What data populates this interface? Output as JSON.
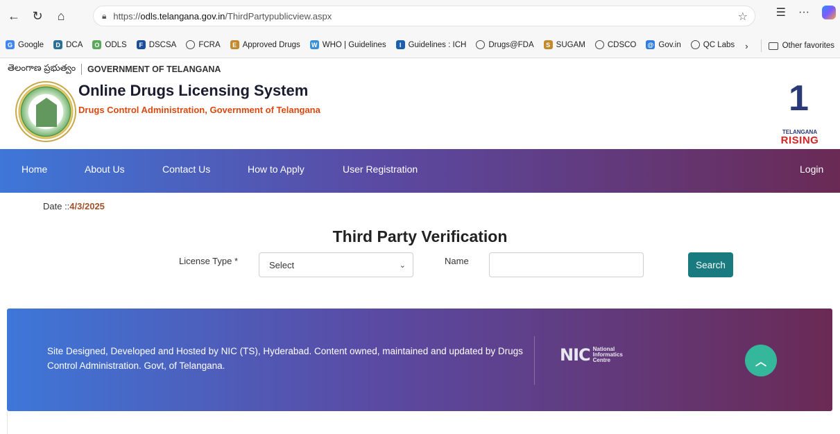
{
  "browser": {
    "url_prefix": "https://",
    "url_domain": "odls.telangana.gov.in",
    "url_path": "/ThirdPartypublicview.aspx",
    "bookmarks": [
      {
        "label": "Google",
        "icon": "G",
        "color": "#4285f4"
      },
      {
        "label": "DCA",
        "icon": "D",
        "color": "#2a6f97"
      },
      {
        "label": "ODLS",
        "icon": "O",
        "color": "#5aa95a"
      },
      {
        "label": "DSCSA",
        "icon": "F",
        "color": "#1c4e9c"
      },
      {
        "label": "FCRA",
        "icon": "globe",
        "color": ""
      },
      {
        "label": "Approved Drugs",
        "icon": "E",
        "color": "#c28a2c"
      },
      {
        "label": "WHO | Guidelines",
        "icon": "W",
        "color": "#3a8fd6"
      },
      {
        "label": "Guidelines : ICH",
        "icon": "I",
        "color": "#1d5fa8"
      },
      {
        "label": "Drugs@FDA",
        "icon": "globe",
        "color": ""
      },
      {
        "label": "SUGAM",
        "icon": "S",
        "color": "#c28a2c"
      },
      {
        "label": "CDSCO",
        "icon": "globe",
        "color": ""
      },
      {
        "label": "Gov.in",
        "icon": "@",
        "color": "#2f7de1"
      },
      {
        "label": "QC Labs",
        "icon": "globe",
        "color": ""
      }
    ],
    "other_favorites": "Other favorites"
  },
  "header": {
    "telugu_text": "తెలంగాణ ప్రభుత్వం",
    "gov_text": "GOVERNMENT OF TELANGANA",
    "title": "Online Drugs Licensing System",
    "subtitle": "Drugs Control Administration, Government of Telangana",
    "rising_one": "1",
    "rising_small": "TELANGANA",
    "rising_big": "RISING"
  },
  "nav": {
    "home": "Home",
    "about": "About Us",
    "contact": "Contact Us",
    "how_to_apply": "How to Apply",
    "user_registration": "User Registration",
    "login": "Login"
  },
  "main": {
    "date_label": "Date ::",
    "date_value": "4/3/2025",
    "section_title": "Third Party Verification",
    "license_type_label": "License Type *",
    "license_type_selected": "Select",
    "name_label": "Name",
    "name_value": "",
    "search_label": "Search"
  },
  "footer": {
    "text": "Site Designed, Developed and Hosted by NIC (TS), Hyderabad. Content owned, maintained and updated by Drugs Control Administration. Govt, of Telangana.",
    "nic_mark": "NIC",
    "nic_line1": "National",
    "nic_line2": "Informatics",
    "nic_line3": "Centre"
  },
  "colors": {
    "accent_orange": "#d9480f",
    "search_button": "#197a80",
    "scroll_top": "#34b79a",
    "gradient_start": "#3e77d8",
    "gradient_end": "#6a2a55"
  }
}
